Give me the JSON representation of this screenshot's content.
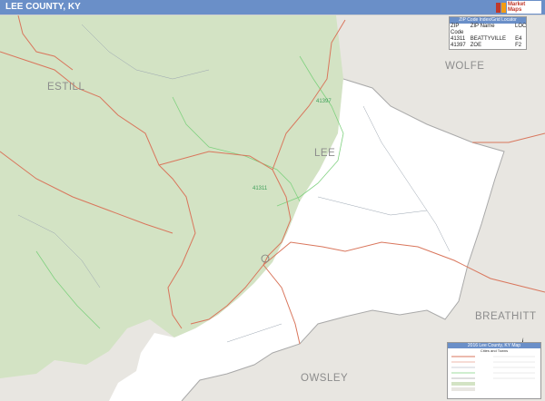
{
  "header": {
    "title": "LEE COUNTY, KY",
    "logo_text": "Market Maps",
    "colors": {
      "bar": "#6a8fc8",
      "text": "#ffffff"
    }
  },
  "map": {
    "county_labels": {
      "estill": "ESTILL",
      "wolfe": "WOLFE",
      "lee": "LEE",
      "breathitt": "BREATHITT",
      "owsley": "OWSLEY"
    },
    "zip_labels": {
      "z41397": "41397",
      "z41311": "41311"
    },
    "colors": {
      "forest": "#d3e3c4",
      "neighbor": "#e8e6e1",
      "county_white": "#ffffff",
      "road_red": "#d9765c",
      "zip_boundary": "#7fd17f",
      "county_border": "#a9a9a9",
      "stream": "#9aa4b0"
    }
  },
  "zip_table": {
    "title": "ZIP Code Index/Grid Locator",
    "headers": [
      "ZIP Code",
      "ZIP Name",
      "LOC"
    ],
    "rows": [
      [
        "41311",
        "BEATTYVILLE",
        "E4"
      ],
      [
        "41397",
        "ZOE",
        "F2"
      ]
    ]
  },
  "legend": {
    "title": "2016 Lee County, KY Map",
    "subtitle": "Cities and Towns",
    "compass": "N"
  }
}
